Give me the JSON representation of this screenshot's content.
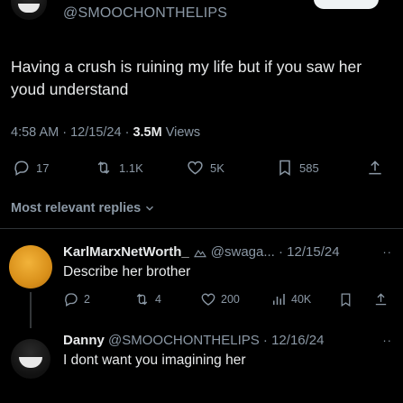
{
  "colors": {
    "background": "#000000",
    "text": "#e7e9ea",
    "muted": "#8b98a5",
    "divider": "#2f3336",
    "orange_avatar": "#e8a22a"
  },
  "post": {
    "handle": "@SMOOCHONTHELIPS",
    "text": "Having a crush is ruining my life but if you saw her youd understand",
    "time": "4:58 AM",
    "date": "12/15/24",
    "views_count": "3.5M",
    "views_label": "Views",
    "stats": {
      "replies": "17",
      "reposts": "1.1K",
      "likes": "5K",
      "bookmarks": "585"
    }
  },
  "replies_header": "Most relevant replies",
  "replies": [
    {
      "name": "KarlMarxNetWorth_",
      "handle_date": "@swaga... · 12/15/24",
      "text": "Describe her brother",
      "more": "··",
      "stats": {
        "replies": "2",
        "reposts": "4",
        "likes": "200",
        "views": "40K"
      }
    },
    {
      "name": "Danny",
      "handle_date": "@SMOOCHONTHELIPS · 12/16/24",
      "text": "I dont want you imagining her",
      "more": "··"
    }
  ],
  "icons": [
    "reply-icon",
    "repost-icon",
    "like-icon",
    "bookmark-icon",
    "share-icon",
    "views-icon",
    "chevron-down-icon",
    "verified-emoji-icon"
  ]
}
